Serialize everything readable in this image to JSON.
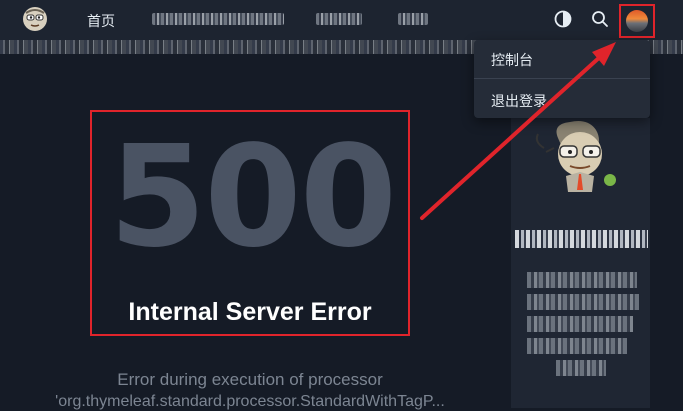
{
  "nav": {
    "home_label": "首页",
    "logo_icon": "mascot-logo-icon",
    "theme_icon": "theme-toggle-icon",
    "search_icon": "search-icon",
    "avatar_icon": "user-avatar-icon"
  },
  "dropdown": {
    "items": [
      {
        "label": "控制台"
      },
      {
        "label": "退出登录"
      }
    ]
  },
  "error": {
    "code": "500",
    "title": "Internal Server Error",
    "description_line1": "Error during execution of processor",
    "description_line2": "'org.thymeleaf.standard.processor.StandardWithTagP..."
  },
  "colors": {
    "highlight_red": "#e0242b",
    "background": "#151b26",
    "topbar": "#1d2430",
    "error_code": "#4a5363"
  }
}
